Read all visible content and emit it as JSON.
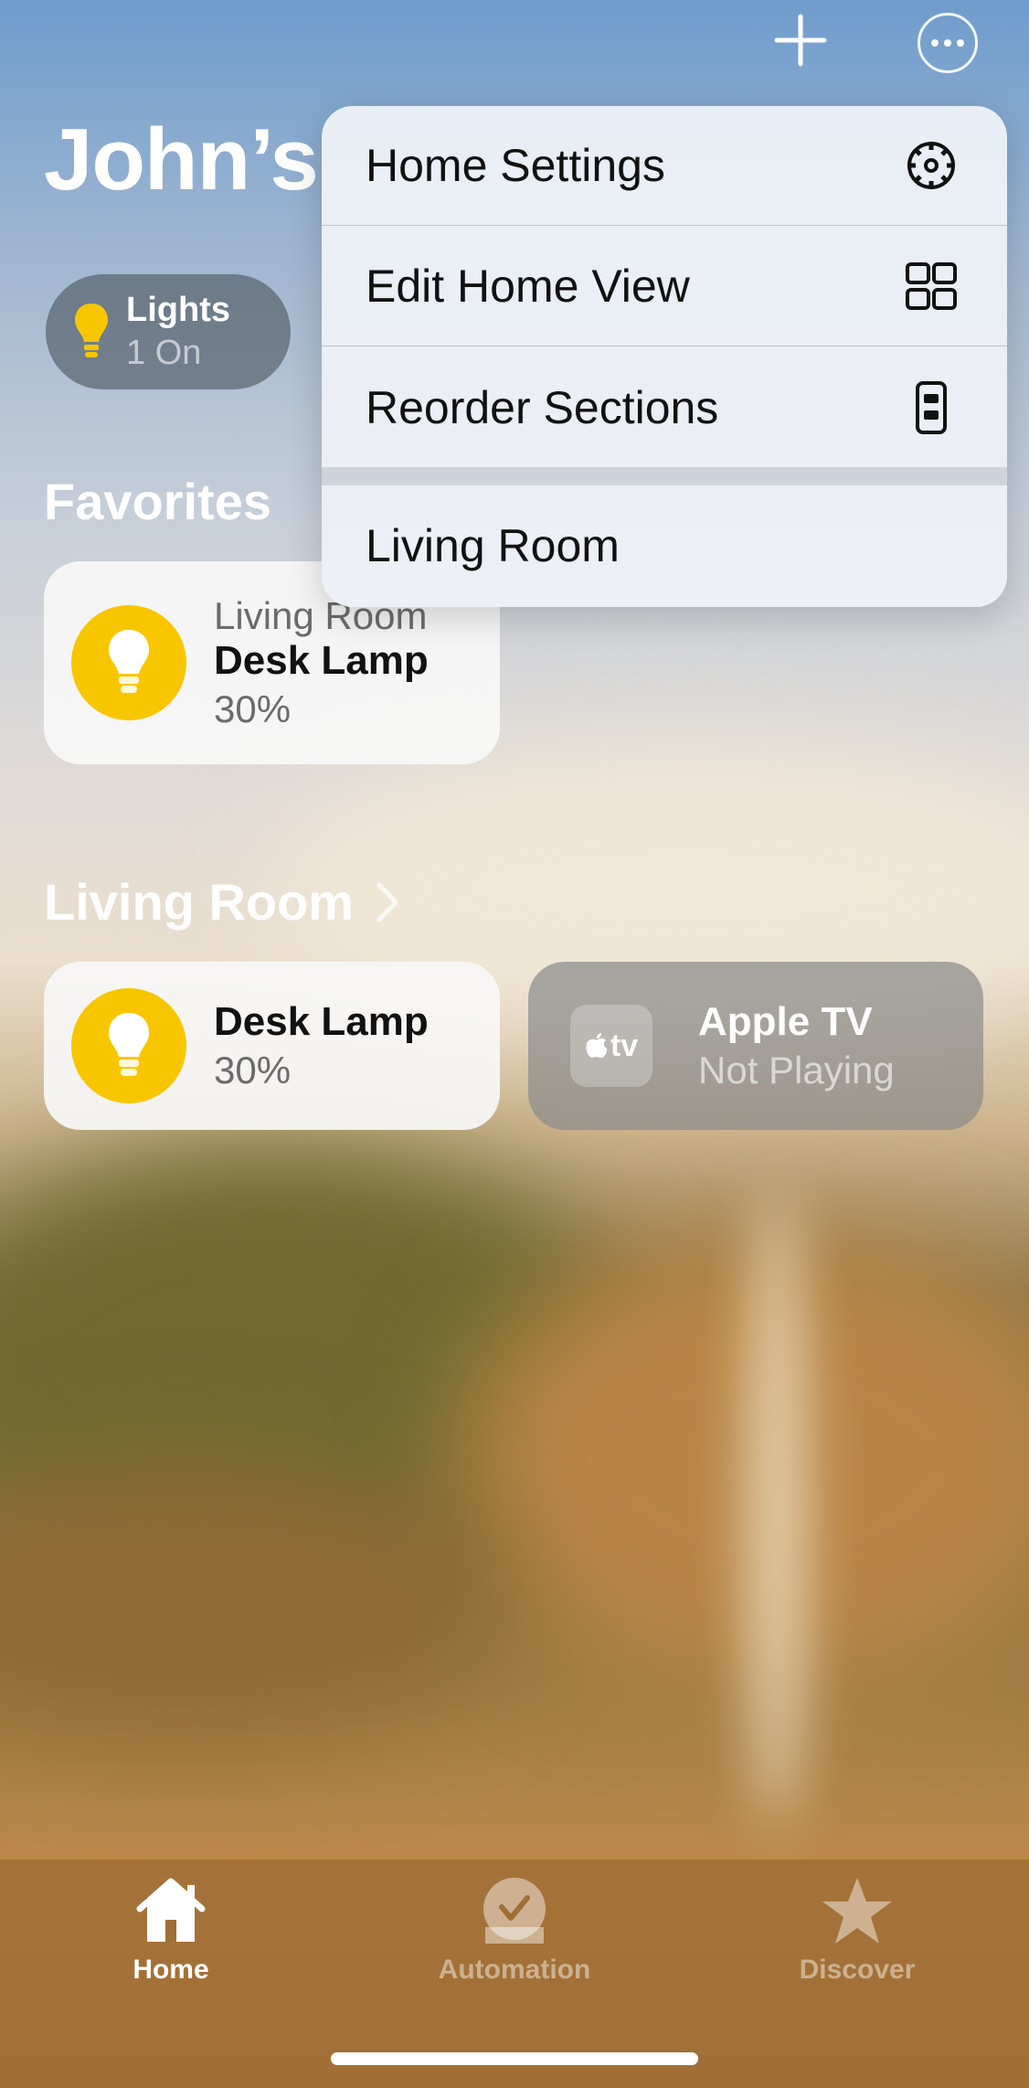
{
  "header": {
    "title": "John’s",
    "add_icon": "plus-icon",
    "more_icon": "ellipsis-circle-icon"
  },
  "status_pills": [
    {
      "title": "Lights",
      "subtitle": "1 On",
      "icon": "lightbulb-icon"
    }
  ],
  "favorites": {
    "title": "Favorites",
    "tiles": [
      {
        "room": "Living Room",
        "name": "Desk Lamp",
        "value": "30%",
        "icon": "lightbulb-icon"
      }
    ]
  },
  "living_room": {
    "title": "Living Room",
    "tiles": [
      {
        "name": "Desk Lamp",
        "value": "30%",
        "icon": "lightbulb-icon"
      },
      {
        "name": "Apple TV",
        "value": "Not Playing",
        "icon": "apple-tv-icon",
        "icon_text": "tv"
      }
    ]
  },
  "menu": {
    "items": [
      {
        "label": "Home Settings",
        "icon": "gear-icon"
      },
      {
        "label": "Edit Home View",
        "icon": "grid-icon"
      },
      {
        "label": "Reorder Sections",
        "icon": "reorder-icon"
      }
    ],
    "rooms": [
      {
        "label": "Living Room"
      }
    ]
  },
  "tabbar": {
    "tabs": [
      {
        "label": "Home",
        "icon": "house-icon",
        "active": true
      },
      {
        "label": "Automation",
        "icon": "clock-check-icon",
        "active": false
      },
      {
        "label": "Discover",
        "icon": "star-icon",
        "active": false
      }
    ]
  },
  "colors": {
    "accent_yellow": "#f8c600",
    "menu_bg": "#eceff6",
    "tabbar_bg": "#a06e37"
  }
}
